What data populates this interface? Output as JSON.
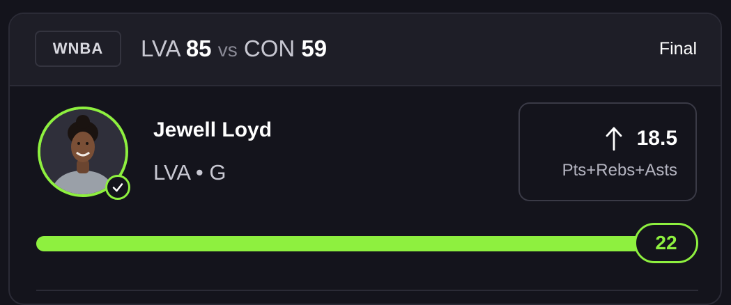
{
  "header": {
    "league": "WNBA",
    "home_team": "LVA",
    "home_score": "85",
    "vs": "vs",
    "away_team": "CON",
    "away_score": "59",
    "status": "Final"
  },
  "player": {
    "name": "Jewell Loyd",
    "team": "LVA",
    "separator": "•",
    "position": "G",
    "avatar_icon": "player-headshot",
    "verified_icon": "check-icon"
  },
  "prop": {
    "direction_icon": "arrow-up-icon",
    "line": "18.5",
    "stat": "Pts+Rebs+Asts"
  },
  "result": {
    "actual": "22",
    "progress_fraction": 1.0
  },
  "colors": {
    "accent": "#8ef03f",
    "background": "#14141c",
    "header_bg": "#1e1e27"
  }
}
